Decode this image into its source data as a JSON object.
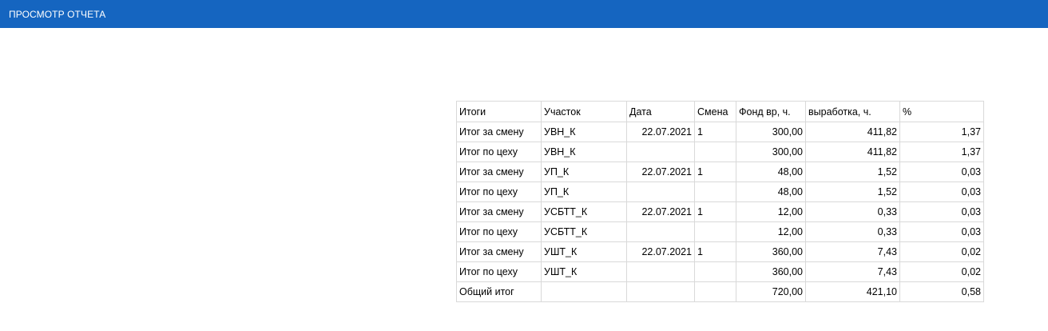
{
  "header": {
    "title": "ПРОСМОТР ОТЧЕТА"
  },
  "colors": {
    "header_bg": "#1565c0",
    "header_text": "#ffffff",
    "grid_border": "#d9d9d9"
  },
  "report": {
    "columns": [
      "Итоги",
      "Участок",
      "Дата",
      "Смена",
      "Фонд вр, ч.",
      "выработка, ч.",
      "%"
    ],
    "rows": [
      [
        "Итог за смену",
        "УВН_К",
        "22.07.2021",
        "1",
        "300,00",
        "411,82",
        "1,37"
      ],
      [
        "Итог по цеху",
        "УВН_К",
        "",
        "",
        "300,00",
        "411,82",
        "1,37"
      ],
      [
        "Итог за смену",
        "УП_К",
        "22.07.2021",
        "1",
        "48,00",
        "1,52",
        "0,03"
      ],
      [
        "Итог по цеху",
        "УП_К",
        "",
        "",
        "48,00",
        "1,52",
        "0,03"
      ],
      [
        "Итог за смену",
        "УСБТТ_К",
        "22.07.2021",
        "1",
        "12,00",
        "0,33",
        "0,03"
      ],
      [
        "Итог по цеху",
        "УСБТТ_К",
        "",
        "",
        "12,00",
        "0,33",
        "0,03"
      ],
      [
        "Итог за смену",
        "УШТ_К",
        "22.07.2021",
        "1",
        "360,00",
        "7,43",
        "0,02"
      ],
      [
        "Итог по цеху",
        "УШТ_К",
        "",
        "",
        "360,00",
        "7,43",
        "0,02"
      ],
      [
        "Общий итог",
        "",
        "",
        "",
        "720,00",
        "421,10",
        "0,58"
      ]
    ]
  }
}
